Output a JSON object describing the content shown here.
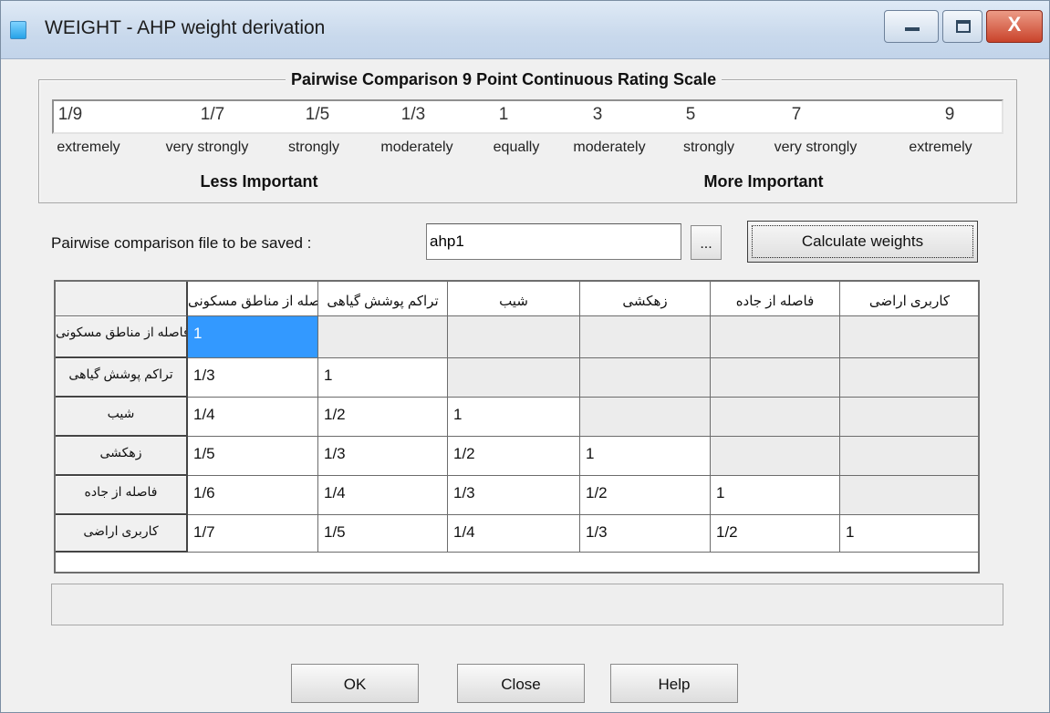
{
  "window": {
    "title": "WEIGHT - AHP weight derivation",
    "close_glyph": "X"
  },
  "scale": {
    "title": "Pairwise Comparison 9 Point Continuous Rating Scale",
    "values": [
      "1/9",
      "1/7",
      "1/5",
      "1/3",
      "1",
      "3",
      "5",
      "7",
      "9"
    ],
    "descriptors": [
      "extremely",
      "very strongly",
      "strongly",
      "moderately",
      "equally",
      "moderately",
      "strongly",
      "very strongly",
      "extremely"
    ],
    "less_label": "Less Important",
    "more_label": "More Important"
  },
  "file": {
    "label": "Pairwise comparison file to be saved :",
    "value": "ahp1",
    "browse_label": "...",
    "calculate_label": "Calculate weights"
  },
  "matrix": {
    "criteria": [
      "فاصله از مناطق مسکونی",
      "تراکم پوشش گیاهی",
      "شیب",
      "زهکشی",
      "فاصله از جاده",
      "کاربری اراضی"
    ],
    "rows": [
      [
        "1",
        "",
        "",
        "",
        "",
        ""
      ],
      [
        "1/3",
        "1",
        "",
        "",
        "",
        ""
      ],
      [
        "1/4",
        "1/2",
        "1",
        "",
        "",
        ""
      ],
      [
        "1/5",
        "1/3",
        "1/2",
        "1",
        "",
        ""
      ],
      [
        "1/6",
        "1/4",
        "1/3",
        "1/2",
        "1",
        ""
      ],
      [
        "1/7",
        "1/5",
        "1/4",
        "1/3",
        "1/2",
        "1"
      ]
    ]
  },
  "status_text": "",
  "buttons": {
    "ok": "OK",
    "close": "Close",
    "help": "Help"
  }
}
